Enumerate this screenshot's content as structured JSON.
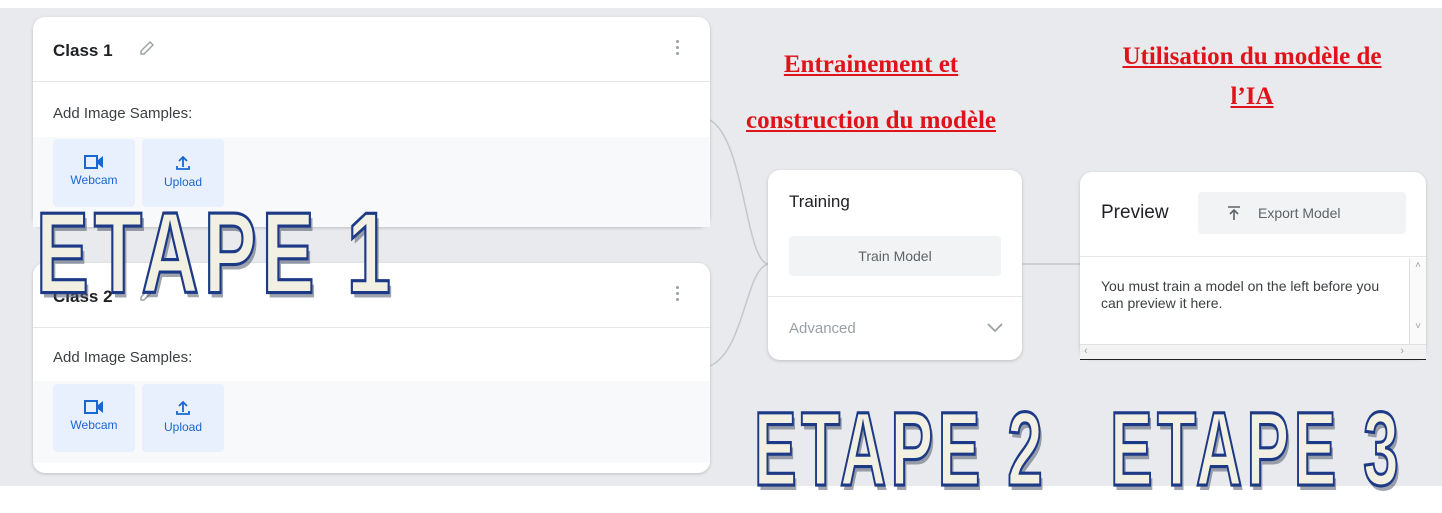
{
  "classes": [
    {
      "title": "Class 1",
      "samples_label": "Add Image Samples:",
      "webcam_label": "Webcam",
      "upload_label": "Upload"
    },
    {
      "title": "Class 2",
      "samples_label": "Add Image Samples:",
      "webcam_label": "Webcam",
      "upload_label": "Upload"
    }
  ],
  "training": {
    "title": "Training",
    "train_button": "Train Model",
    "advanced_label": "Advanced"
  },
  "preview": {
    "title": "Preview",
    "export_button": "Export Model",
    "message": "You must train a model on the left before you can preview it here."
  },
  "annotations": {
    "train_heading_line1": "Entrainement et",
    "train_heading_line2": "construction du modèle",
    "use_heading_line1": "Utilisation du modèle de",
    "use_heading_line2": "l’IA",
    "step1": "ETAPE 1",
    "step2": "ETAPE 2",
    "step3": "ETAPE 3"
  },
  "colors": {
    "accent_blue": "#1967d2",
    "annotation_red": "#e0131a",
    "step_outline": "#1d3a86"
  },
  "icons": [
    "edit-pencil-icon",
    "more-vert-icon",
    "videocam-icon",
    "upload-icon",
    "chevron-down-icon",
    "publish-icon"
  ]
}
